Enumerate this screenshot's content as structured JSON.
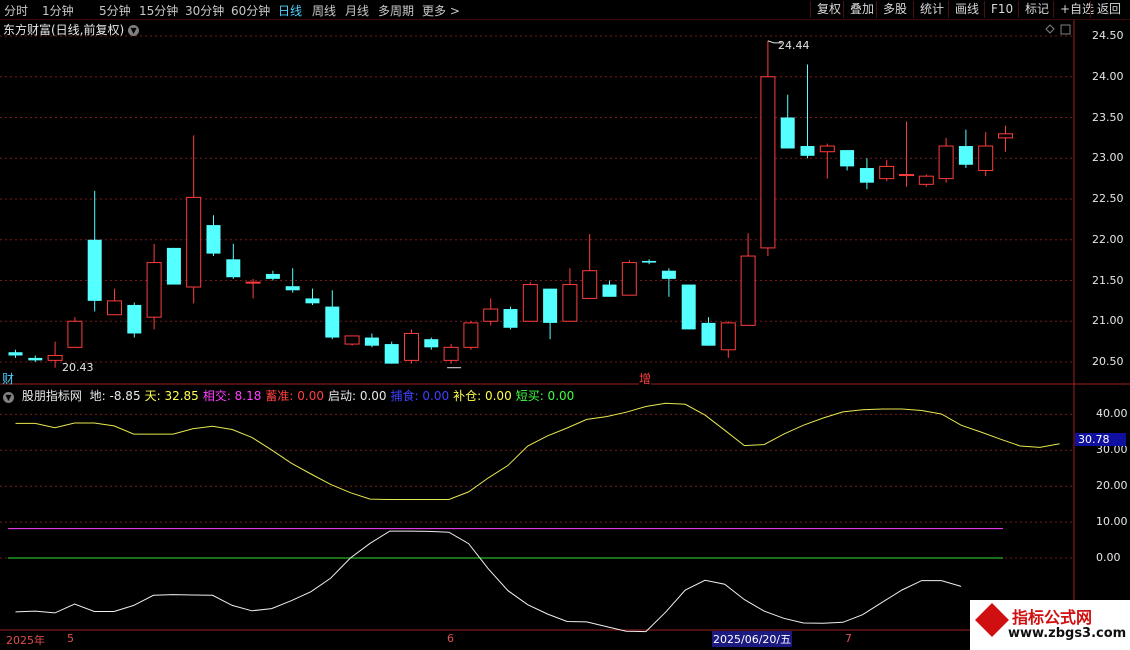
{
  "toolbar": {
    "tabs": [
      "分时",
      "1分钟",
      "5分钟",
      "15分钟",
      "30分钟",
      "60分钟",
      "日线",
      "周线",
      "月线",
      "多周期",
      "更多 >"
    ],
    "active_tab": "日线",
    "right_buttons": [
      "复权",
      "叠加",
      "多股",
      "统计",
      "画线",
      "F10",
      "标记",
      "+自选",
      "返回"
    ]
  },
  "chart_title": "东方财富(日线,前复权)",
  "main_markers": {
    "high_label": "24.44",
    "low_label": "20.43",
    "left_tag": "财",
    "mid_tag": "增"
  },
  "indicator": {
    "name": "股朋指标网",
    "items": [
      {
        "label": "地:",
        "value": "-8.85",
        "color": "#e8e8e8"
      },
      {
        "label": "天:",
        "value": "32.85",
        "color": "#ffff50"
      },
      {
        "label": "相交:",
        "value": "8.18",
        "color": "#ff40ff"
      },
      {
        "label": "蓄准:",
        "value": "0.00",
        "color": "#ff4040"
      },
      {
        "label": "启动:",
        "value": "0.00",
        "color": "#e8e8e8"
      },
      {
        "label": "捕食:",
        "value": "0.00",
        "color": "#4040ff"
      },
      {
        "label": "补仓:",
        "value": "0.00",
        "color": "#ffff50"
      },
      {
        "label": "短买:",
        "value": "0.00",
        "color": "#40ff40"
      }
    ],
    "current_value_tag": "30.78"
  },
  "axis": {
    "price_ticks": [
      "24.50",
      "24.00",
      "23.50",
      "23.00",
      "22.50",
      "22.00",
      "21.50",
      "21.00",
      "20.50"
    ],
    "ind_ticks": [
      "40.00",
      "30.00",
      "20.00",
      "10.00",
      "0.00"
    ],
    "date_labels": [
      "2025年",
      "5",
      "6",
      "2025/06/20/五",
      "7"
    ]
  },
  "watermark": {
    "line1": "指标公式网",
    "line2": "www.zbgs3.com"
  },
  "chart_data": {
    "type": "candlestick",
    "ohlc": [
      [
        20.62,
        20.65,
        20.55,
        20.58
      ],
      [
        20.55,
        20.58,
        20.5,
        20.52
      ],
      [
        20.52,
        20.75,
        20.43,
        20.58
      ],
      [
        20.68,
        21.05,
        20.68,
        21.0
      ],
      [
        22.0,
        22.6,
        21.12,
        21.25
      ],
      [
        21.08,
        21.4,
        21.08,
        21.25
      ],
      [
        21.2,
        21.23,
        20.8,
        20.85
      ],
      [
        21.05,
        21.95,
        20.9,
        21.72
      ],
      [
        21.9,
        21.9,
        21.45,
        21.45
      ],
      [
        21.42,
        23.28,
        21.22,
        22.52
      ],
      [
        22.18,
        22.3,
        21.8,
        21.83
      ],
      [
        21.76,
        21.95,
        21.52,
        21.54
      ],
      [
        21.48,
        21.52,
        21.28,
        21.48
      ],
      [
        21.58,
        21.62,
        21.5,
        21.52
      ],
      [
        21.43,
        21.65,
        21.35,
        21.38
      ],
      [
        21.28,
        21.4,
        21.2,
        21.22
      ],
      [
        21.18,
        21.38,
        20.78,
        20.8
      ],
      [
        20.72,
        20.82,
        20.7,
        20.82
      ],
      [
        20.8,
        20.85,
        20.68,
        20.7
      ],
      [
        20.72,
        20.75,
        20.48,
        20.48
      ],
      [
        20.52,
        20.9,
        20.48,
        20.85
      ],
      [
        20.78,
        20.8,
        20.65,
        20.68
      ],
      [
        20.52,
        20.72,
        20.48,
        20.68
      ],
      [
        20.68,
        21.0,
        20.65,
        20.98
      ],
      [
        21.0,
        21.28,
        20.95,
        21.15
      ],
      [
        21.15,
        21.18,
        20.9,
        20.92
      ],
      [
        21.0,
        21.48,
        21.0,
        21.45
      ],
      [
        21.4,
        21.4,
        20.78,
        20.98
      ],
      [
        21.0,
        21.65,
        21.0,
        21.45
      ],
      [
        21.28,
        22.07,
        21.28,
        21.62
      ],
      [
        21.45,
        21.5,
        21.3,
        21.3
      ],
      [
        21.32,
        21.75,
        21.32,
        21.72
      ],
      [
        21.74,
        21.76,
        21.7,
        21.72
      ],
      [
        21.62,
        21.65,
        21.3,
        21.52
      ],
      [
        21.45,
        21.45,
        20.9,
        20.9
      ],
      [
        20.98,
        21.05,
        20.7,
        20.7
      ],
      [
        20.65,
        21.0,
        20.55,
        20.98
      ],
      [
        20.95,
        22.08,
        20.95,
        21.8
      ],
      [
        21.9,
        24.44,
        21.8,
        24.0
      ],
      [
        23.5,
        23.78,
        23.13,
        23.12
      ],
      [
        23.15,
        24.15,
        23.0,
        23.03
      ],
      [
        23.08,
        23.18,
        22.75,
        23.15
      ],
      [
        23.1,
        23.1,
        22.85,
        22.9
      ],
      [
        22.88,
        23.0,
        22.62,
        22.7
      ],
      [
        22.75,
        22.98,
        22.72,
        22.9
      ],
      [
        22.8,
        23.45,
        22.65,
        22.8
      ],
      [
        22.68,
        22.8,
        22.65,
        22.78
      ],
      [
        22.75,
        23.25,
        22.7,
        23.15
      ],
      [
        23.15,
        23.35,
        22.88,
        22.92
      ],
      [
        22.85,
        23.32,
        22.78,
        23.15
      ],
      [
        23.25,
        23.4,
        23.08,
        23.3
      ]
    ],
    "indicator_tian": [
      37.5,
      37.5,
      36.3,
      37.6,
      37.6,
      36.8,
      34.5,
      34.5,
      34.5,
      36.0,
      36.7,
      35.8,
      33.6,
      30.1,
      26.4,
      23.4,
      20.5,
      18.2,
      16.4,
      16.3,
      16.3,
      16.3,
      16.3,
      18.4,
      22.3,
      25.8,
      31.2,
      34.0,
      36.2,
      38.6,
      39.4,
      40.6,
      42.2,
      43.1,
      42.8,
      39.8,
      35.6,
      31.3,
      31.6,
      34.5,
      37.0,
      39.0,
      40.7,
      41.3,
      41.5,
      41.5,
      41.1,
      40.1,
      37.0,
      35.1,
      33.1,
      31.2,
      30.8,
      31.8
    ],
    "indicator_di": [
      -15.0,
      -14.8,
      -15.3,
      -12.8,
      -14.9,
      -14.9,
      -13.2,
      -10.4,
      -10.2,
      -10.3,
      -10.4,
      -13.2,
      -14.7,
      -14.1,
      -11.9,
      -9.4,
      -5.6,
      0.0,
      4.1,
      7.5,
      7.5,
      7.4,
      7.2,
      4.0,
      -3.0,
      -9.1,
      -13.0,
      -15.6,
      -17.7,
      -17.8,
      -19.1,
      -20.4,
      -20.5,
      -15.1,
      -8.9,
      -6.2,
      -7.3,
      -11.6,
      -14.8,
      -16.8,
      -18.1,
      -18.2,
      -17.9,
      -15.8,
      -12.3,
      -8.9,
      -6.3,
      -6.3,
      -7.9
    ],
    "xiangjiao": 8.18,
    "zero_line": 0,
    "price_ylim": [
      20.3,
      24.7
    ],
    "ind_ylim": [
      -20.9,
      47.6
    ]
  }
}
